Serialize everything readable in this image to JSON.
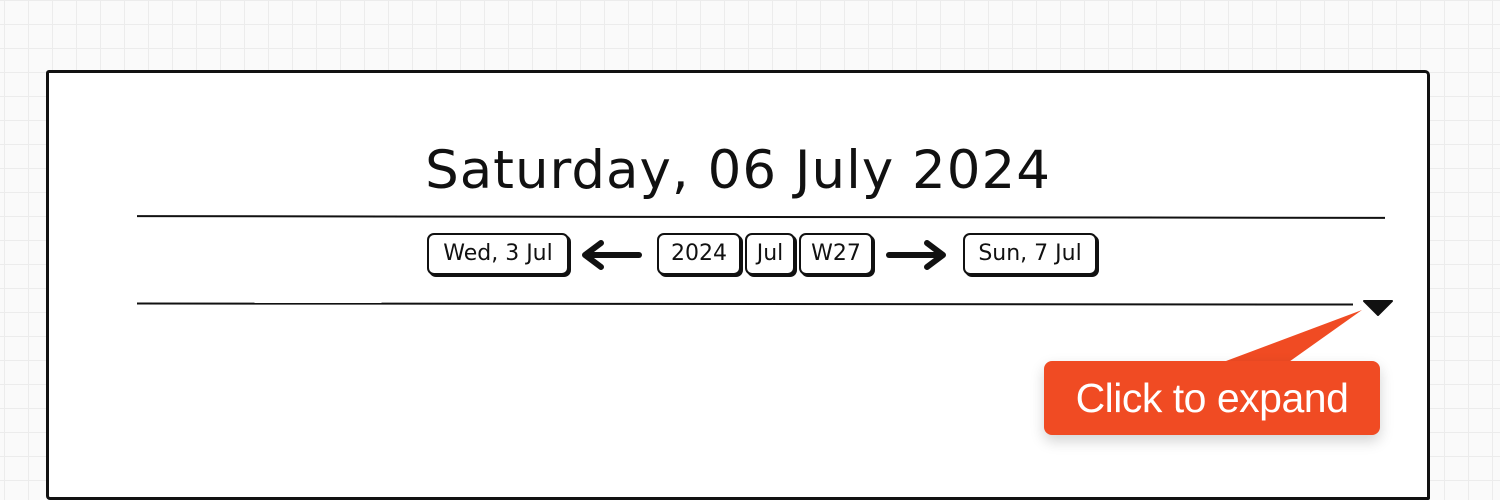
{
  "note": {
    "title": "Saturday, 06 July 2024"
  },
  "nav": {
    "prev_day_label": "Wed, 3 Jul",
    "year_label": "2024",
    "month_label": "Jul",
    "week_label": "W27",
    "next_day_label": "Sun, 7 Jul",
    "back_arrow_icon": "arrow-left-icon",
    "forward_arrow_icon": "arrow-right-icon"
  },
  "expand": {
    "icon": "caret-down-icon"
  },
  "tooltip": {
    "text": "Click to expand",
    "color": "#f04b23"
  }
}
